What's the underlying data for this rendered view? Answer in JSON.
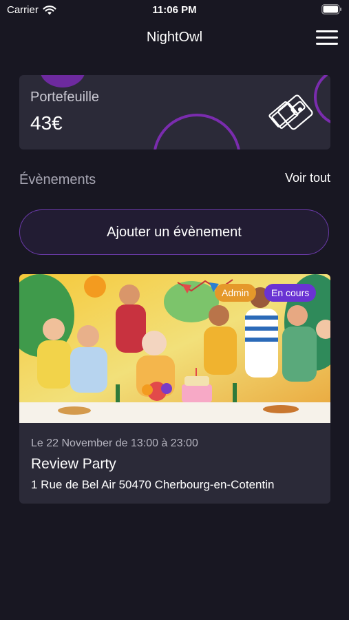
{
  "status_bar": {
    "carrier": "Carrier",
    "time": "11:06 PM",
    "icons": [
      "wifi-icon",
      "battery-icon"
    ]
  },
  "nav": {
    "title": "NightOwl",
    "menu_icon": "hamburger-menu-icon"
  },
  "wallet": {
    "label": "Portefeuille",
    "amount": "43€",
    "icon": "wallet-icon",
    "accent_color": "#7a2cae"
  },
  "events_section": {
    "title": "Évènements",
    "see_all_label": "Voir tout"
  },
  "add_event": {
    "label": "Ajouter un évènement",
    "border_color": "#6a3aa8"
  },
  "event": {
    "badges": [
      {
        "label": "Admin",
        "color": "#e5982a"
      },
      {
        "label": "En cours",
        "color": "#6a33d3"
      }
    ],
    "date_text": "Le 22 November de 13:00 à 23:00",
    "title": "Review Party",
    "address": "1 Rue de Bel Air 50470 Cherbourg-en-Cotentin",
    "image_icon": "party-illustration"
  },
  "colors": {
    "background": "#181722",
    "card": "#2b2a38"
  }
}
